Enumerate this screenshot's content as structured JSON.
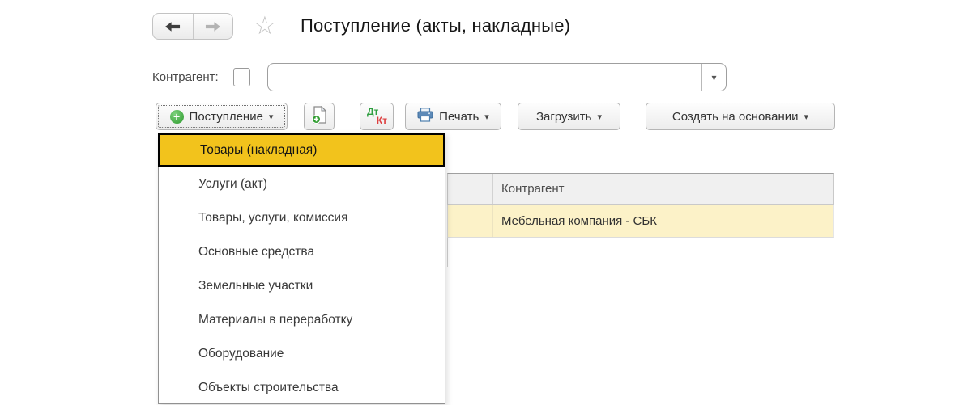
{
  "page": {
    "title": "Поступление (акты, накладные)"
  },
  "icons": {
    "back_arrow": "back-arrow",
    "forward_arrow": "forward-arrow",
    "favorite_star": "☆",
    "dropdown_arrow": "▾",
    "combo_arrow": "▾",
    "plus": "+"
  },
  "filter": {
    "label": "Контрагент:",
    "checkbox_checked": false,
    "value": "",
    "placeholder": ""
  },
  "toolbar": {
    "receipt": {
      "label": "Поступление"
    },
    "dtkt": {
      "dt": "Дт",
      "kt": "Кт"
    },
    "print": {
      "label": "Печать"
    },
    "load": {
      "label": "Загрузить"
    },
    "create_based": {
      "label": "Создать на основании"
    }
  },
  "menu": {
    "items": [
      {
        "label": "Товары (накладная)",
        "highlighted": true
      },
      {
        "label": "Услуги (акт)",
        "highlighted": false
      },
      {
        "label": "Товары, услуги, комиссия",
        "highlighted": false
      },
      {
        "label": "Основные средства",
        "highlighted": false
      },
      {
        "label": "Земельные участки",
        "highlighted": false
      },
      {
        "label": "Материалы в переработку",
        "highlighted": false
      },
      {
        "label": "Оборудование",
        "highlighted": false
      },
      {
        "label": "Объекты строительства",
        "highlighted": false
      }
    ]
  },
  "table": {
    "columns": [
      {
        "label": ""
      },
      {
        "label": "Контрагент"
      }
    ],
    "rows": [
      {
        "counterparty": "Мебельная компания - СБК",
        "selected": true
      }
    ]
  },
  "colors": {
    "menu_highlight": "#f2c31c",
    "menu_highlight_border": "#000000",
    "selected_row": "#fcf2c8",
    "table_header_bg": "#f0f0f0",
    "add_icon_green": "#2e9b2e",
    "debit_green": "#2e9e3f",
    "credit_red": "#dd4040",
    "printer_blue": "#5d8ab8"
  }
}
